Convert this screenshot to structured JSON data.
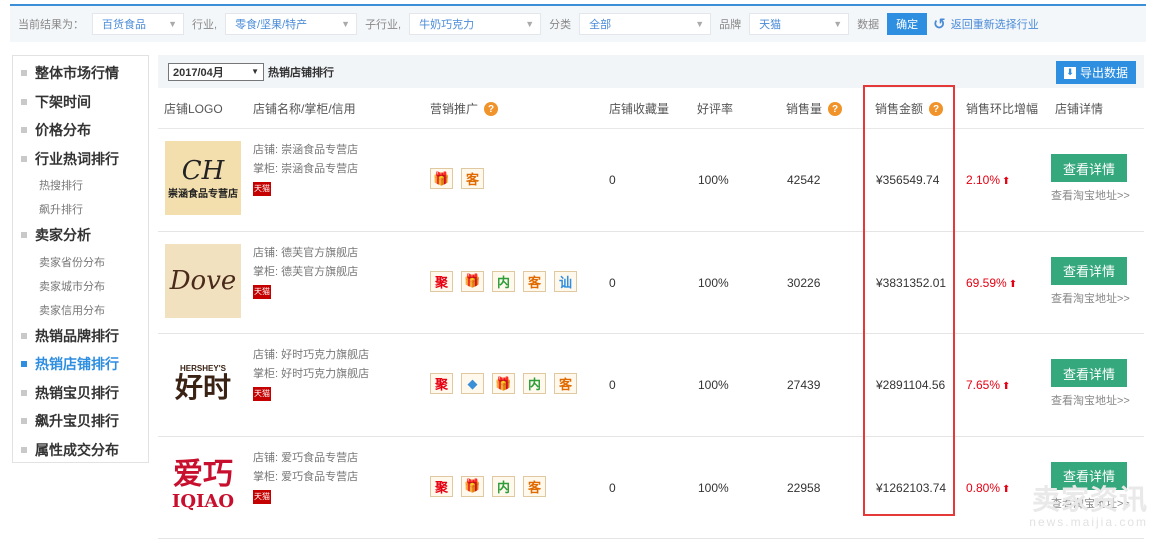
{
  "filters": {
    "current_label": "当前结果为：",
    "category_value": "百货食品",
    "industry_label": "行业,",
    "industry_value": "零食/坚果/特产",
    "subindustry_label": "子行业,",
    "subindustry_value": "牛奶巧克力",
    "classify_label": "分类",
    "classify_value": "全部",
    "brand_label": "品牌",
    "brand_value": "天猫",
    "data_label": "数据",
    "confirm_label": "确定",
    "back_label": "返回重新选择行业"
  },
  "sidebar": {
    "items": [
      {
        "label": "整体市场行情",
        "type": "main"
      },
      {
        "label": "下架时间",
        "type": "main"
      },
      {
        "label": "价格分布",
        "type": "main"
      },
      {
        "label": "行业热词排行",
        "type": "main"
      },
      {
        "label": "热搜排行",
        "type": "sub"
      },
      {
        "label": "飙升排行",
        "type": "sub"
      },
      {
        "label": "卖家分析",
        "type": "main"
      },
      {
        "label": "卖家省份分布",
        "type": "sub"
      },
      {
        "label": "卖家城市分布",
        "type": "sub"
      },
      {
        "label": "卖家信用分布",
        "type": "sub"
      },
      {
        "label": "热销品牌排行",
        "type": "main"
      },
      {
        "label": "热销店铺排行",
        "type": "main",
        "active": true
      },
      {
        "label": "热销宝贝排行",
        "type": "main"
      },
      {
        "label": "飙升宝贝排行",
        "type": "main"
      },
      {
        "label": "属性成交分布",
        "type": "main"
      }
    ]
  },
  "main": {
    "month_value": "2017/04月",
    "title": "热销店铺排行",
    "export_label": "导出数据",
    "headers": {
      "logo": "店铺LOGO",
      "name": "店铺名称/掌柜/信用",
      "promo": "营销推广",
      "fav": "店铺收藏量",
      "rating": "好评率",
      "sales": "销售量",
      "amount": "销售金额",
      "growth": "销售环比增幅",
      "detail": "店铺详情"
    },
    "help_icon": "?",
    "rows": [
      {
        "logo_text": "崇涵食品专营店",
        "logo_mark": "CH",
        "shop": "店铺: 崇涵食品专营店",
        "keeper": "掌柜: 崇涵食品专营店",
        "tmall": "天猫",
        "badges": [
          "🎁",
          "客"
        ],
        "fav": "0",
        "rating": "100%",
        "sales": "42542",
        "amount": "¥356549.74",
        "growth": "2.10%",
        "detail_label": "查看详情",
        "tb_link": "查看淘宝地址>>"
      },
      {
        "logo_text": "德芙",
        "logo_mark": "Dove",
        "shop": "店铺: 德芙官方旗舰店",
        "keeper": "掌柜: 德芙官方旗舰店",
        "tmall": "天猫",
        "badges": [
          "聚",
          "🎁",
          "内",
          "客",
          "讪"
        ],
        "fav": "0",
        "rating": "100%",
        "sales": "30226",
        "amount": "¥3831352.01",
        "growth": "69.59%",
        "detail_label": "查看详情",
        "tb_link": "查看淘宝地址>>"
      },
      {
        "logo_text": "好时",
        "logo_mark": "HERSHEY'S",
        "shop": "店铺: 好时巧克力旗舰店",
        "keeper": "掌柜: 好时巧克力旗舰店",
        "tmall": "天猫",
        "badges": [
          "聚",
          "◆",
          "🎁",
          "内",
          "客"
        ],
        "fav": "0",
        "rating": "100%",
        "sales": "27439",
        "amount": "¥2891104.56",
        "growth": "7.65%",
        "detail_label": "查看详情",
        "tb_link": "查看淘宝地址>>"
      },
      {
        "logo_text": "爱巧",
        "logo_mark": "IQIAO",
        "shop": "店铺: 爱巧食品专营店",
        "keeper": "掌柜: 爱巧食品专营店",
        "tmall": "天猫",
        "badges": [
          "聚",
          "🎁",
          "内",
          "客"
        ],
        "fav": "0",
        "rating": "100%",
        "sales": "22958",
        "amount": "¥1262103.74",
        "growth": "0.80%",
        "detail_label": "查看详情",
        "tb_link": "查看淘宝地址>>"
      }
    ]
  },
  "watermark": {
    "big": "卖家资讯",
    "small": "news.maijia.com"
  },
  "colors": {
    "accent": "#2e8ee0",
    "detail_button": "#35a87d",
    "growth": "#e60012",
    "highlight_box": "#e53939"
  }
}
